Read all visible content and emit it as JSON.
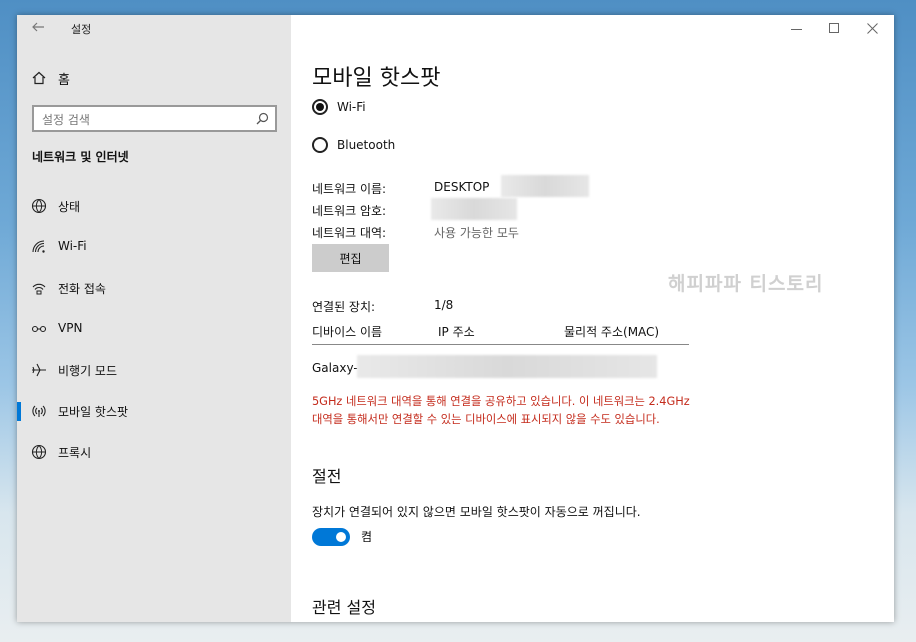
{
  "window": {
    "title": "설정"
  },
  "sidebar": {
    "home_label": "홈",
    "search_placeholder": "설정 검색",
    "section_title": "네트워크 및 인터넷",
    "items": [
      {
        "label": "상태",
        "icon": "globe-status-icon"
      },
      {
        "label": "Wi-Fi",
        "icon": "wifi-icon"
      },
      {
        "label": "전화 접속",
        "icon": "dialup-icon"
      },
      {
        "label": "VPN",
        "icon": "vpn-icon"
      },
      {
        "label": "비행기 모드",
        "icon": "airplane-icon"
      },
      {
        "label": "모바일 핫스팟",
        "icon": "hotspot-icon",
        "active": true
      },
      {
        "label": "프록시",
        "icon": "globe-icon"
      }
    ]
  },
  "main": {
    "page_title": "모바일 핫스팟",
    "share_options": [
      {
        "label": "Wi-Fi",
        "selected": true
      },
      {
        "label": "Bluetooth",
        "selected": false
      }
    ],
    "network_name_label": "네트워크 이름:",
    "network_name_value": "DESKTOP",
    "network_password_label": "네트워크 암호:",
    "network_band_label": "네트워크 대역:",
    "network_band_value": "사용 가능한 모두",
    "edit_button": "편집",
    "connected_devices_label": "연결된 장치:",
    "connected_devices_value": "1/8",
    "table_headers": [
      "디바이스 이름",
      "IP 주소",
      "물리적 주소(MAC)"
    ],
    "device_name": "Galaxy-",
    "warning": "5GHz 네트워크 대역을 통해 연결을 공유하고 있습니다. 이 네트워크는 2.4GHz 대역을 통해서만 연결할 수 있는 디바이스에 표시되지 않을 수도 있습니다.",
    "power_saving_title": "절전",
    "power_saving_desc": "장치가 연결되어 있지 않으면 모바일 핫스팟이 자동으로 꺼집니다.",
    "toggle_label": "켬",
    "toggle_on": true,
    "related_title": "관련 설정",
    "watermark": "해피파파 티스토리"
  },
  "colors": {
    "accent": "#0078d7",
    "warning": "#c42b1c",
    "sidebar_bg": "#e6e6e6"
  }
}
